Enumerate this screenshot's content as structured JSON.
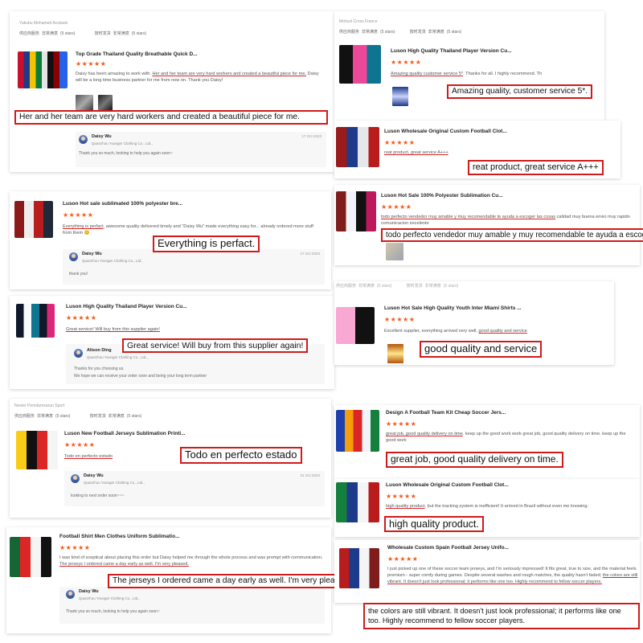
{
  "labels": {
    "supplier_service": "供应商服务",
    "very_satisfied": "非常满意",
    "on_time_shipment": "按时发货",
    "five_stars": "(5 stars)",
    "stars": "★★★★★"
  },
  "reviews": [
    {
      "reviewer": "Yakubu Mohamed Acolasie",
      "title": "Top Grade Thailand Quality Breathable Quick D...",
      "text_parts": [
        "Daisy has been amazing to work with. ",
        "Her and her team are very hard workers and created a beautiful piec",
        "e for me.",
        " Daisy will be a long time business partner for me from now on. Thank you Daisy!"
      ],
      "callout": "Her and her team are very hard workers and created a beautiful piece for me.",
      "reply": {
        "name": "Daisy Wu",
        "company": "Quanzhou Younger Clothing Co., Ltd.,",
        "date": "17 Oct 2023",
        "text": "Thank you so much, looking to help you again soon~"
      }
    },
    {
      "title": "Luson Hot sale sublimated 100% polyester bre...",
      "text_parts": [
        "Everything is perfact",
        ", awesome quality delivered timely and \"Daisy Wu\" made everything easy for... already ordered more stuff from them ",
        "😊"
      ],
      "callout": "Everything is perfact.",
      "reply": {
        "name": "Daisy Wu",
        "company": "Quanzhou Younger Clothing Co., Ltd.,",
        "date": "17 Oct 2023",
        "text": "thank you!"
      }
    },
    {
      "title": "Luson High Quality Thailand Player Version Cu...",
      "text_parts": [
        "Great service! Will buy from this supplier again!"
      ],
      "callout": "Great service! Will buy from this supplier again!",
      "reply": {
        "name": "Alison Ding",
        "company": "Quanzhou Younger Clothing Co., Ltd.,",
        "text": "Thanks for you choosing us.",
        "text2": "We hope we can receive your order soon and being your long term partner"
      }
    },
    {
      "reviewer": "Nester Pemdaresarun Sport",
      "title": "Luson New Football Jerseys Sublimation Printi...",
      "text_parts": [
        "Todo en perfecto estado"
      ],
      "callout": "Todo en perfecto estado",
      "reply": {
        "name": "Daisy Wu",
        "company": "Quanzhou Younger Clothing Co., Ltd.,",
        "date": "31 Oct 2023",
        "text": "looking to next order soon~~~"
      }
    },
    {
      "title": "Football Shirt Men Clothes Uniform Sublimatio...",
      "text_parts": [
        "I was kind of sceptical about placing this order but Daisy helped me through the whole process and was prompt with communication. ",
        "The jerseys I ordered came a day early as well. I'm very pleased."
      ],
      "callout": "The jerseys I ordered came a day early as well. I'm very pleased.",
      "reply": {
        "name": "Daisy Wu",
        "company": "Quanzhou Younger Clothing Co., Ltd.,",
        "text": "Thank you so much, looking to help you again soon~"
      }
    },
    {
      "reviewer": "Mohcel Cross France",
      "title": "Luson High Quality Thailand Player Version Cu...",
      "text_parts": [
        "Amazing quality customer service 5*",
        ". Thanks for all. I highly recommend. Th"
      ],
      "callout": "Amazing quality, customer service 5*."
    },
    {
      "title": "Luson Wholesale Original Custom Football Clot...",
      "text_parts": [
        "reat product, great service A+++"
      ],
      "callout": "reat product, great service A+++"
    },
    {
      "title": "Luson Hot Sale 100% Polyester Sublimation Cu...",
      "text_parts": [
        "todo perfecto vendedor muy amable y muy recomendable te ayuda a escoger las cosas",
        " calidad muy buena envio muy rapido comunicacion excelente"
      ],
      "callout": "todo perfecto vendedor muy amable y muy recomendable te ayuda a escoger las"
    },
    {
      "title": "Luson Hot Sale High Quality Youth Inter Miami Shirts ...",
      "text_parts": [
        "Excellent supplier, everything arrived very well, ",
        "good quality and service"
      ],
      "callout": "good quality and service"
    },
    {
      "title": "Design A Football Team Kit Cheap Soccer Jers...",
      "text_parts": [
        "great job, good quality delivery on time",
        ". keep up the good work work great job, good quality delivery on time. keep up the good work"
      ],
      "callout": "great job, good quality delivery on time."
    },
    {
      "title": "Luson Wholesale Original Custom Football Clot...",
      "text_parts": [
        "high quality product",
        ", but the tracking system is inefficient! It arrived in Brazil without even me knowing."
      ],
      "callout": "high quality product."
    },
    {
      "title": "Wholesale Custom Spain Football Jersey Unifo...",
      "text_parts": [
        "I just picked up one of these soccer team jerseys, and I'm seriously impressed! It fits great, true to size, and the material feels premium - super comfy during games. Despite several washes and rough matches, the quality hasn't faded; ",
        "the colors are still vibrant. It doesn't just look professional; it performs like one too. Highly recommend to fellow soccer players."
      ],
      "callout": "the colors are still vibrant. It doesn't just look professional; it performs like one too. Highly recommend to fellow soccer players."
    }
  ]
}
